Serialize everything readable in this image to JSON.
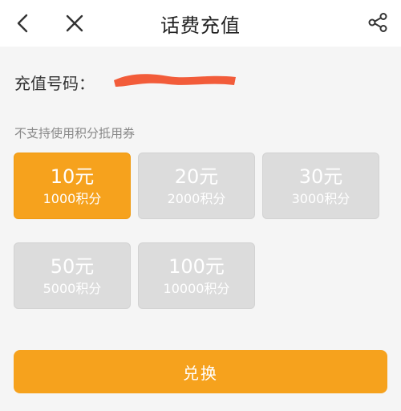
{
  "header": {
    "title": "话费充值",
    "back_icon": "chevron-left-icon",
    "close_icon": "close-icon",
    "share_icon": "share-icon"
  },
  "phone": {
    "label": "充值号码：",
    "value_redacted": true
  },
  "notice": "不支持使用积分抵用券",
  "options": [
    {
      "amount": "10元",
      "points": "1000积分",
      "selected": true
    },
    {
      "amount": "20元",
      "points": "2000积分",
      "selected": false
    },
    {
      "amount": "30元",
      "points": "3000积分",
      "selected": false
    },
    {
      "amount": "50元",
      "points": "5000积分",
      "selected": false
    },
    {
      "amount": "100元",
      "points": "10000积分",
      "selected": false
    }
  ],
  "submit_label": "兑换",
  "colors": {
    "accent": "#f6a21d",
    "option_inactive": "#dcdcdc",
    "redaction": "#f25c3a",
    "background": "#f5f5f5"
  }
}
